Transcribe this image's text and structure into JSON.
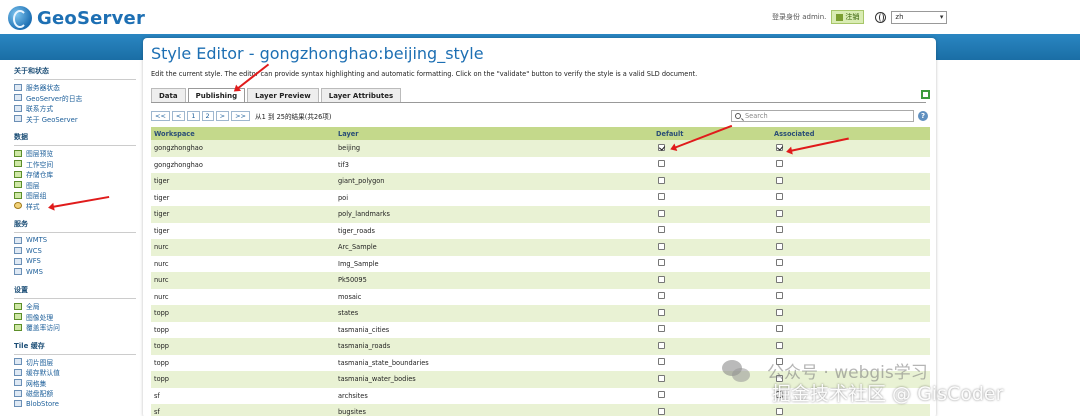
{
  "header": {
    "logo_text": "GeoServer",
    "user_label": "登录身份 admin.",
    "logout_label": "注销",
    "language": "zh"
  },
  "sidebar": {
    "sections": [
      {
        "title": "关于和状态",
        "items": [
          {
            "label": "服务器状态",
            "icon": "server-status-icon"
          },
          {
            "label": "GeoServer的日志",
            "icon": "log-icon"
          },
          {
            "label": "联系方式",
            "icon": "contact-icon"
          },
          {
            "label": "关于 GeoServer",
            "icon": "about-icon"
          }
        ]
      },
      {
        "title": "数据",
        "items": [
          {
            "label": "图层预览",
            "icon": "layer-preview-icon"
          },
          {
            "label": "工作空间",
            "icon": "workspace-icon"
          },
          {
            "label": "存储仓库",
            "icon": "store-icon"
          },
          {
            "label": "图层",
            "icon": "layer-icon"
          },
          {
            "label": "图层组",
            "icon": "layer-group-icon"
          },
          {
            "label": "样式",
            "icon": "style-icon"
          }
        ]
      },
      {
        "title": "服务",
        "items": [
          {
            "label": "WMTS",
            "icon": "wmts-icon"
          },
          {
            "label": "WCS",
            "icon": "wcs-icon"
          },
          {
            "label": "WFS",
            "icon": "wfs-icon"
          },
          {
            "label": "WMS",
            "icon": "wms-icon"
          }
        ]
      },
      {
        "title": "设置",
        "items": [
          {
            "label": "全局",
            "icon": "global-settings-icon"
          },
          {
            "label": "图像处理",
            "icon": "image-processing-icon"
          },
          {
            "label": "覆盖率访问",
            "icon": "coverage-access-icon"
          }
        ]
      },
      {
        "title": "Tile 缓存",
        "items": [
          {
            "label": "切片图层",
            "icon": "tile-layers-icon"
          },
          {
            "label": "缓存默认值",
            "icon": "caching-defaults-icon"
          },
          {
            "label": "网格集",
            "icon": "gridsets-icon"
          },
          {
            "label": "磁盘配额",
            "icon": "disk-quota-icon"
          },
          {
            "label": "BlobStore",
            "icon": "blobstore-icon"
          }
        ]
      }
    ]
  },
  "main": {
    "title": "Style Editor - gongzhonghao:beijing_style",
    "description": "Edit the current style. The editor can provide syntax highlighting and automatic formatting. Click on the \"validate\" button to verify the style is a valid SLD document.",
    "tabs": [
      "Data",
      "Publishing",
      "Layer Preview",
      "Layer Attributes"
    ],
    "active_tab": "Publishing",
    "pager": {
      "first": "<<",
      "prev": "<",
      "pages": [
        "1",
        "2"
      ],
      "next": ">",
      "last": ">>",
      "info": "从1 到 25的结果(共26项)"
    },
    "search_placeholder": "Search",
    "help_label": "?",
    "table": {
      "columns": [
        "Workspace",
        "Layer",
        "Default",
        "Associated"
      ],
      "rows": [
        {
          "workspace": "gongzhonghao",
          "layer": "beijing",
          "default": true,
          "associated": true
        },
        {
          "workspace": "gongzhonghao",
          "layer": "tif3",
          "default": false,
          "associated": false
        },
        {
          "workspace": "tiger",
          "layer": "giant_polygon",
          "default": false,
          "associated": false
        },
        {
          "workspace": "tiger",
          "layer": "poi",
          "default": false,
          "associated": false
        },
        {
          "workspace": "tiger",
          "layer": "poly_landmarks",
          "default": false,
          "associated": false
        },
        {
          "workspace": "tiger",
          "layer": "tiger_roads",
          "default": false,
          "associated": false
        },
        {
          "workspace": "nurc",
          "layer": "Arc_Sample",
          "default": false,
          "associated": false
        },
        {
          "workspace": "nurc",
          "layer": "Img_Sample",
          "default": false,
          "associated": false
        },
        {
          "workspace": "nurc",
          "layer": "Pk50095",
          "default": false,
          "associated": false
        },
        {
          "workspace": "nurc",
          "layer": "mosaic",
          "default": false,
          "associated": false
        },
        {
          "workspace": "topp",
          "layer": "states",
          "default": false,
          "associated": false
        },
        {
          "workspace": "topp",
          "layer": "tasmania_cities",
          "default": false,
          "associated": false
        },
        {
          "workspace": "topp",
          "layer": "tasmania_roads",
          "default": false,
          "associated": false
        },
        {
          "workspace": "topp",
          "layer": "tasmania_state_boundaries",
          "default": false,
          "associated": false
        },
        {
          "workspace": "topp",
          "layer": "tasmania_water_bodies",
          "default": false,
          "associated": false
        },
        {
          "workspace": "sf",
          "layer": "archsites",
          "default": false,
          "associated": false
        },
        {
          "workspace": "sf",
          "layer": "bugsites",
          "default": false,
          "associated": false
        }
      ]
    }
  },
  "watermark": {
    "line1": "公众号 · webgis学习",
    "line2": "掘金技术社区 @ GisCoder"
  },
  "colors": {
    "brand_blue": "#1d6fb3",
    "header_bar": "#2a86c2",
    "table_header": "#c4d98b",
    "row_alt": "#e9f2d4",
    "annotation_red": "#e01b1b"
  }
}
